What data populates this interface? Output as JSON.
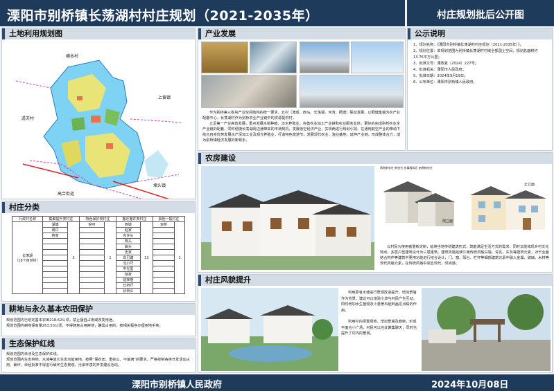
{
  "header": {
    "title": "溧阳市别桥镇长荡湖村村庄规划（2021-2035年）",
    "subtitle": "村庄规划批后公开图"
  },
  "sections": {
    "land_use": "土地利用规划图",
    "industry": "产业发展",
    "notice": "公示说明",
    "farmhouse": "农房建设",
    "village_class": "村庄分类",
    "farmland": "耕地与永久基本农田保护",
    "eco": "生态保护红线",
    "landscape": "村庄风貌提升"
  },
  "map_labels": {
    "north": "横本村",
    "west": "道夫村",
    "east": "上黄镇",
    "south_west": "高合街道",
    "south_east": "埭头镇"
  },
  "notice_items": [
    "1、规划名称：《溧阳市别桥镇长荡湖村村庄规划（2021-2035年）》；",
    "2、规划位置：本规划范围为别桥镇长荡湖村村域全部国土空间，规划总面积约13.76平方公里；",
    "3、批准文号：溧政复〔2024〕227号；",
    "4、批准机关：溧阳市人民政府；",
    "5、批准日期：2024年9月19日；",
    "6、公布单位：溧阳市别桥镇人民政府。"
  ],
  "industry_text": [
    "作为别桥第三板块产业空间结构的统一要求，五村（渡成、西马、长荡湖、河湾、稠塘）联动发展，以稠塘集镇为农产业配套中心，长荡湖村作为别桥农业产业链中的资源提供村。",
    "立足第一产业高效发展，重点发展水稻种植、淡水养殖业，完善农业加工产业链和农业服务业体，更好的完成别桥农业全产业链的配套，同时便捷长荡湖周边通带来的市场契机，发展低空经济产业，实现两进行规划引领。在通用航空产业的带动下结合自身优势发展水产深加工业及观光养殖业，打造特色旅游节，发展现代农业，渔业基地、延伸产业链，形成整体合力，成为别桥镇经济发展的新顿手。"
  ],
  "farmhouse_text": "以村民为使用者重新定制，延续当地传统建筑形式，既能满足生活方式的需求，同时又能体现乡村文化特点，多层户型建筑设计为三层建筑。建筑风格延续江南传统风格白墙、青瓦，东瓦等建筑元素，对于业面结合构件等建筑中更用功能进行结合设计，门、窗、阳台、栏杆等细部建筑元素中融入金属、玻璃、木材等现代风格元素，在传统风格中突显现代，时尚感。",
  "farmhouse_labels": {
    "axon": "两侧新农社 新农社 农事服务区 南侧新农社",
    "front": "正立面",
    "side": "侧立面"
  },
  "landscape_text": [
    "利用原有水塘进行景观改造提升，增加景墙作为背景，建议可以体验小波与村民产生互动，同时增加水生植物及少量景石起到画龙点睛的作用。",
    "利用村内闲置场地，增加景墙及廊架，形成平面合小广场，村民可以在此聚集聊天，同时也提升了村内的景观。"
  ],
  "farmland_text": [
    "规划范围内已划定基本农田218.62公顷，禁止擅自占用或改变用途。",
    "规划范围内耕地保有量263.53公顷，不得随意占用耕地，确需占用的，按相关程序办理用地手续。"
  ],
  "eco_text": [
    "规划范围内未涉及生态保护红线。",
    "规划范围内生态林地、水域等其它生态功能用地，按照“保农田、重控山、不填满”的要求，严格控制各类开发活动占用、破坏，未经批准不得进行破坏生态景观、污染环境的开发建设活动。"
  ],
  "village_table": {
    "headers": [
      "行政村名称",
      "集聚提升类村庄",
      "特色保护类村庄",
      "搬迁撤并类村庄",
      "其他一般村庄"
    ],
    "name_cell": [
      "长荡湖",
      "（18个自然村）"
    ],
    "col_counts": [
      "3",
      "1",
      "13",
      "1"
    ],
    "jiju": [
      "湖塘",
      "闸口",
      "蒋家"
    ],
    "tese": [
      "倪可"
    ],
    "banqian": [
      "西城",
      "赵家",
      "东许头",
      "蒋头",
      "曲头",
      "史家",
      "车巳塘",
      "北小圩",
      "中光里",
      "徐家",
      "陆家巷",
      "长桥圩",
      "长桥头"
    ],
    "qita": [
      "双桥"
    ]
  },
  "footer": {
    "left": "溧阳市别桥镇人民政府",
    "right": "2024年10月08日"
  }
}
